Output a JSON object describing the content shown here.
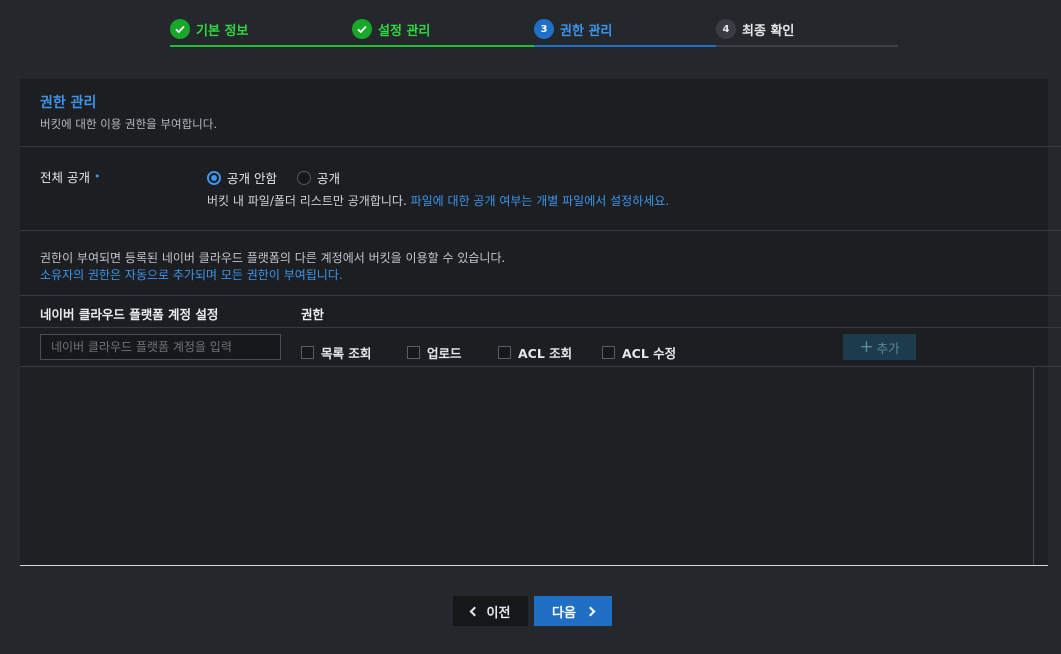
{
  "stepper": {
    "steps": [
      {
        "num": "1",
        "label": "기본 정보",
        "state": "done"
      },
      {
        "num": "2",
        "label": "설정 관리",
        "state": "done"
      },
      {
        "num": "3",
        "label": "권한 관리",
        "state": "active"
      },
      {
        "num": "4",
        "label": "최종 확인",
        "state": "todo"
      }
    ]
  },
  "section": {
    "title": "권한 관리",
    "desc": "버킷에 대한 이용 권한을 부여합니다."
  },
  "public": {
    "label": "전체 공개",
    "required_mark": "•",
    "options": [
      "공개 안함",
      "공개"
    ],
    "selected": "공개 안함",
    "note": "버킷 내 파일/폴더 리스트만 공개합니다.",
    "note_link": "파일에 대한 공개 여부는 개별 파일에서 설정하세요."
  },
  "info": {
    "line1": "권한이 부여되면 등록된 네이버 클라우드 플랫폼의 다른 계정에서 버킷을 이용할 수 있습니다.",
    "line2": "소유자의 권한은 자동으로 추가되며 모든 권한이 부여됩니다."
  },
  "table": {
    "header_account": "네이버 클라우드 플랫폼 계정 설정",
    "header_permission": "권한",
    "account_placeholder": "네이버 클라우드 플랫폼 계정을 입력",
    "permissions": [
      "목록 조회",
      "업로드",
      "ACL 조회",
      "ACL 수정"
    ],
    "add_label": "추가",
    "add_icon": "plus-icon"
  },
  "nav": {
    "prev_label": "이전",
    "next_label": "다음"
  },
  "colors": {
    "accent_blue": "#1f6fc4",
    "link_blue": "#3d95ec",
    "done_green": "#17a82a",
    "background": "#24272c",
    "panel": "#1c1e22"
  }
}
